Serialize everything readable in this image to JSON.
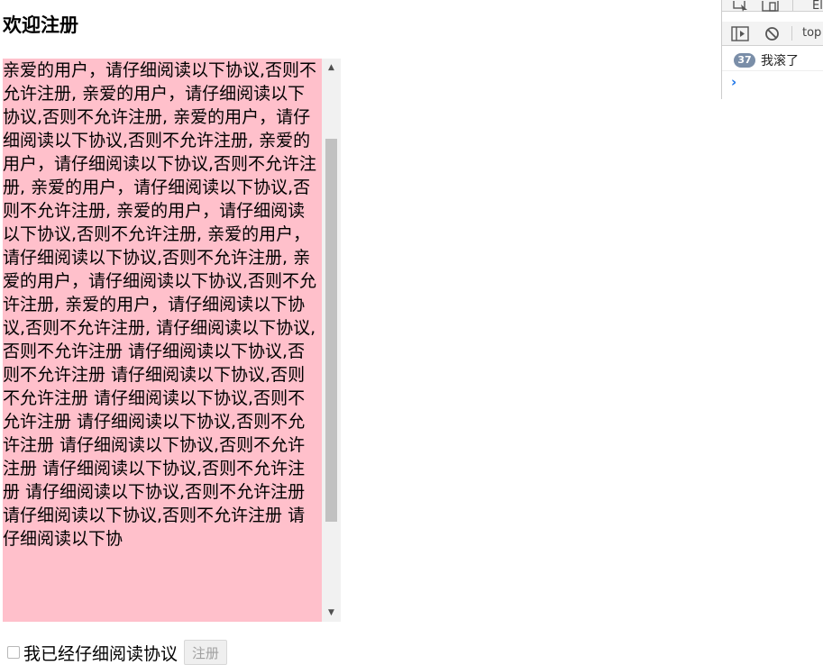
{
  "page": {
    "title": "欢迎注册"
  },
  "agreement": {
    "text": "亲爱的用户，请仔细阅读以下协议,否则不允许注册, 亲爱的用户，请仔细阅读以下协议,否则不允许注册, 亲爱的用户，请仔细阅读以下协议,否则不允许注册, 亲爱的用户，请仔细阅读以下协议,否则不允许注册, 亲爱的用户，请仔细阅读以下协议,否则不允许注册, 亲爱的用户，请仔细阅读以下协议,否则不允许注册, 亲爱的用户，请仔细阅读以下协议,否则不允许注册, 亲爱的用户，请仔细阅读以下协议,否则不允许注册, 亲爱的用户，请仔细阅读以下协议,否则不允许注册, 请仔细阅读以下协议,否则不允许注册 请仔细阅读以下协议,否则不允许注册 请仔细阅读以下协议,否则不允许注册 请仔细阅读以下协议,否则不允许注册 请仔细阅读以下协议,否则不允许注册 请仔细阅读以下协议,否则不允许注册 请仔细阅读以下协议,否则不允许注册 请仔细阅读以下协议,否则不允许注册 请仔细阅读以下协议,否则不允许注册 请仔细阅读以下协",
    "background_color": "#ffc0cb",
    "scroll_position": 0.22
  },
  "form": {
    "checkbox_label": "我已经仔细阅读协议",
    "checkbox_checked": false,
    "register_button": "注册",
    "register_disabled": true
  },
  "devtools": {
    "tab_partial": "El",
    "context": "top",
    "console_count": "37",
    "console_message": "我滚了",
    "prompt_symbol": "›"
  },
  "colors": {
    "badge": "#7a8ea8",
    "prompt": "#1a73e8"
  }
}
